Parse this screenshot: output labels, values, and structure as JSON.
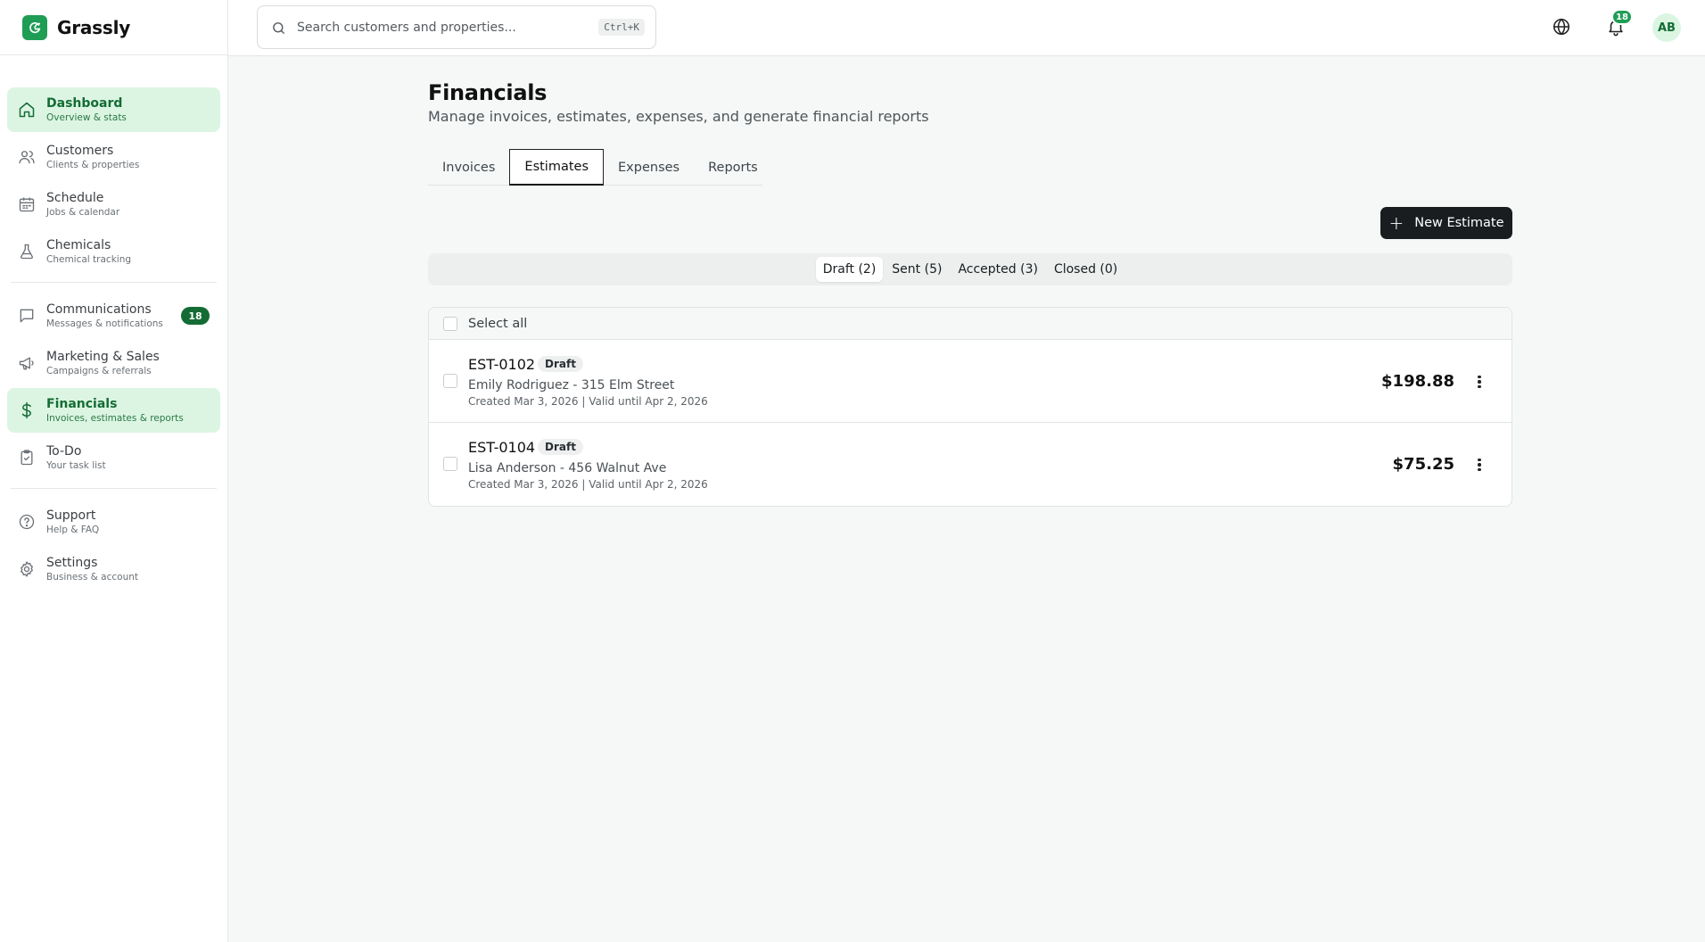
{
  "app": {
    "name": "Grassly"
  },
  "search": {
    "placeholder": "Search customers and properties...",
    "shortcut": "Ctrl+K"
  },
  "header": {
    "notifications_count": "18",
    "user_initials": "AB"
  },
  "sidebar": {
    "items": [
      {
        "label": "Dashboard",
        "sub": "Overview & stats",
        "icon": "home-icon",
        "active": true
      },
      {
        "label": "Customers",
        "sub": "Clients & properties",
        "icon": "users-icon"
      },
      {
        "label": "Schedule",
        "sub": "Jobs & calendar",
        "icon": "calendar-icon"
      },
      {
        "label": "Chemicals",
        "sub": "Chemical tracking",
        "icon": "flask-icon"
      },
      {
        "label": "Communications",
        "sub": "Messages & notifications",
        "icon": "message-icon",
        "badge": "18"
      },
      {
        "label": "Marketing & Sales",
        "sub": "Campaigns & referrals",
        "icon": "megaphone-icon"
      },
      {
        "label": "Financials",
        "sub": "Invoices, estimates & reports",
        "icon": "dollar-icon",
        "active": true
      },
      {
        "label": "To-Do",
        "sub": "Your task list",
        "icon": "clipboard-icon"
      },
      {
        "label": "Support",
        "sub": "Help & FAQ",
        "icon": "help-icon"
      },
      {
        "label": "Settings",
        "sub": "Business & account",
        "icon": "gear-icon"
      }
    ]
  },
  "page": {
    "title": "Financials",
    "subtitle": "Manage invoices, estimates, expenses, and generate financial reports"
  },
  "tabs": [
    "Invoices",
    "Estimates",
    "Expenses",
    "Reports"
  ],
  "active_tab": "Estimates",
  "actions": {
    "new_estimate": "New Estimate"
  },
  "filters": [
    "Draft (2)",
    "Sent (5)",
    "Accepted (3)",
    "Closed (0)"
  ],
  "active_filter": "Draft (2)",
  "list": {
    "select_all": "Select all",
    "rows": [
      {
        "id": "EST-0102",
        "status": "Draft",
        "customer": "Emily Rodriguez - 315 Elm Street",
        "meta": "Created Mar 3, 2026 | Valid until Apr 2, 2026",
        "amount": "$198.88"
      },
      {
        "id": "EST-0104",
        "status": "Draft",
        "customer": "Lisa Anderson - 456 Walnut Ave",
        "meta": "Created Mar 3, 2026 | Valid until Apr 2, 2026",
        "amount": "$75.25"
      }
    ]
  },
  "colors": {
    "brand": "#1f9d55",
    "active_bg": "#dcf5e3",
    "active_text": "#146c34",
    "button_dark": "#1a1d1f"
  }
}
